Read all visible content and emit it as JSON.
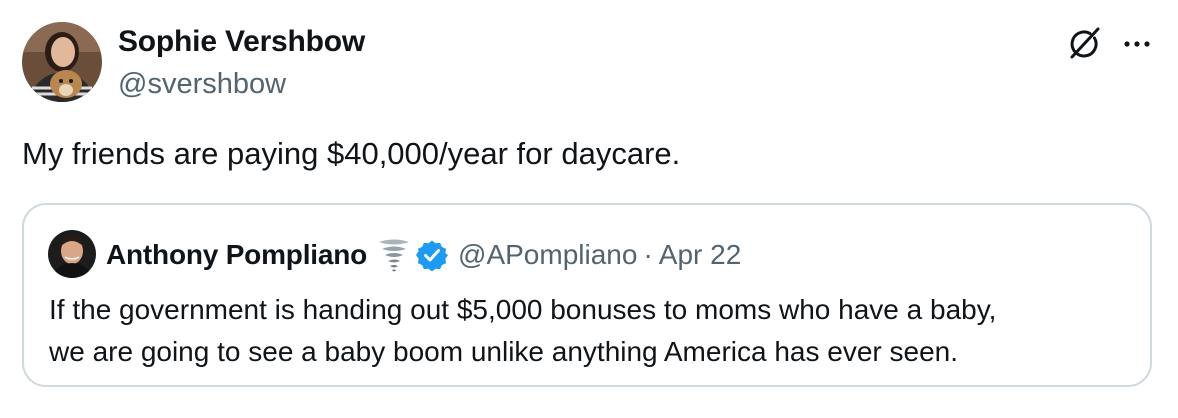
{
  "author": {
    "name": "Sophie Vershbow",
    "handle": "@svershbow",
    "avatar": "avatar-woman-with-dog"
  },
  "icons": {
    "grok": "grok-icon",
    "more": "more-options-icon"
  },
  "tweet": {
    "text": "My friends are paying $40,000/year for daycare."
  },
  "quoted_tweet": {
    "name": "Anthony Pompliano",
    "emoji": "🌪",
    "verified": true,
    "handle": "@APompliano",
    "separator": "·",
    "date": "Apr 22",
    "text_lines": [
      "If the government is handing out $5,000 bonuses to moms who have a baby,",
      "we are going to see a baby boom unlike anything America has ever seen."
    ]
  },
  "colors": {
    "text": "#0f1419",
    "secondary": "#536471",
    "border": "#cfd9de",
    "verified": "#1d9bf0"
  }
}
